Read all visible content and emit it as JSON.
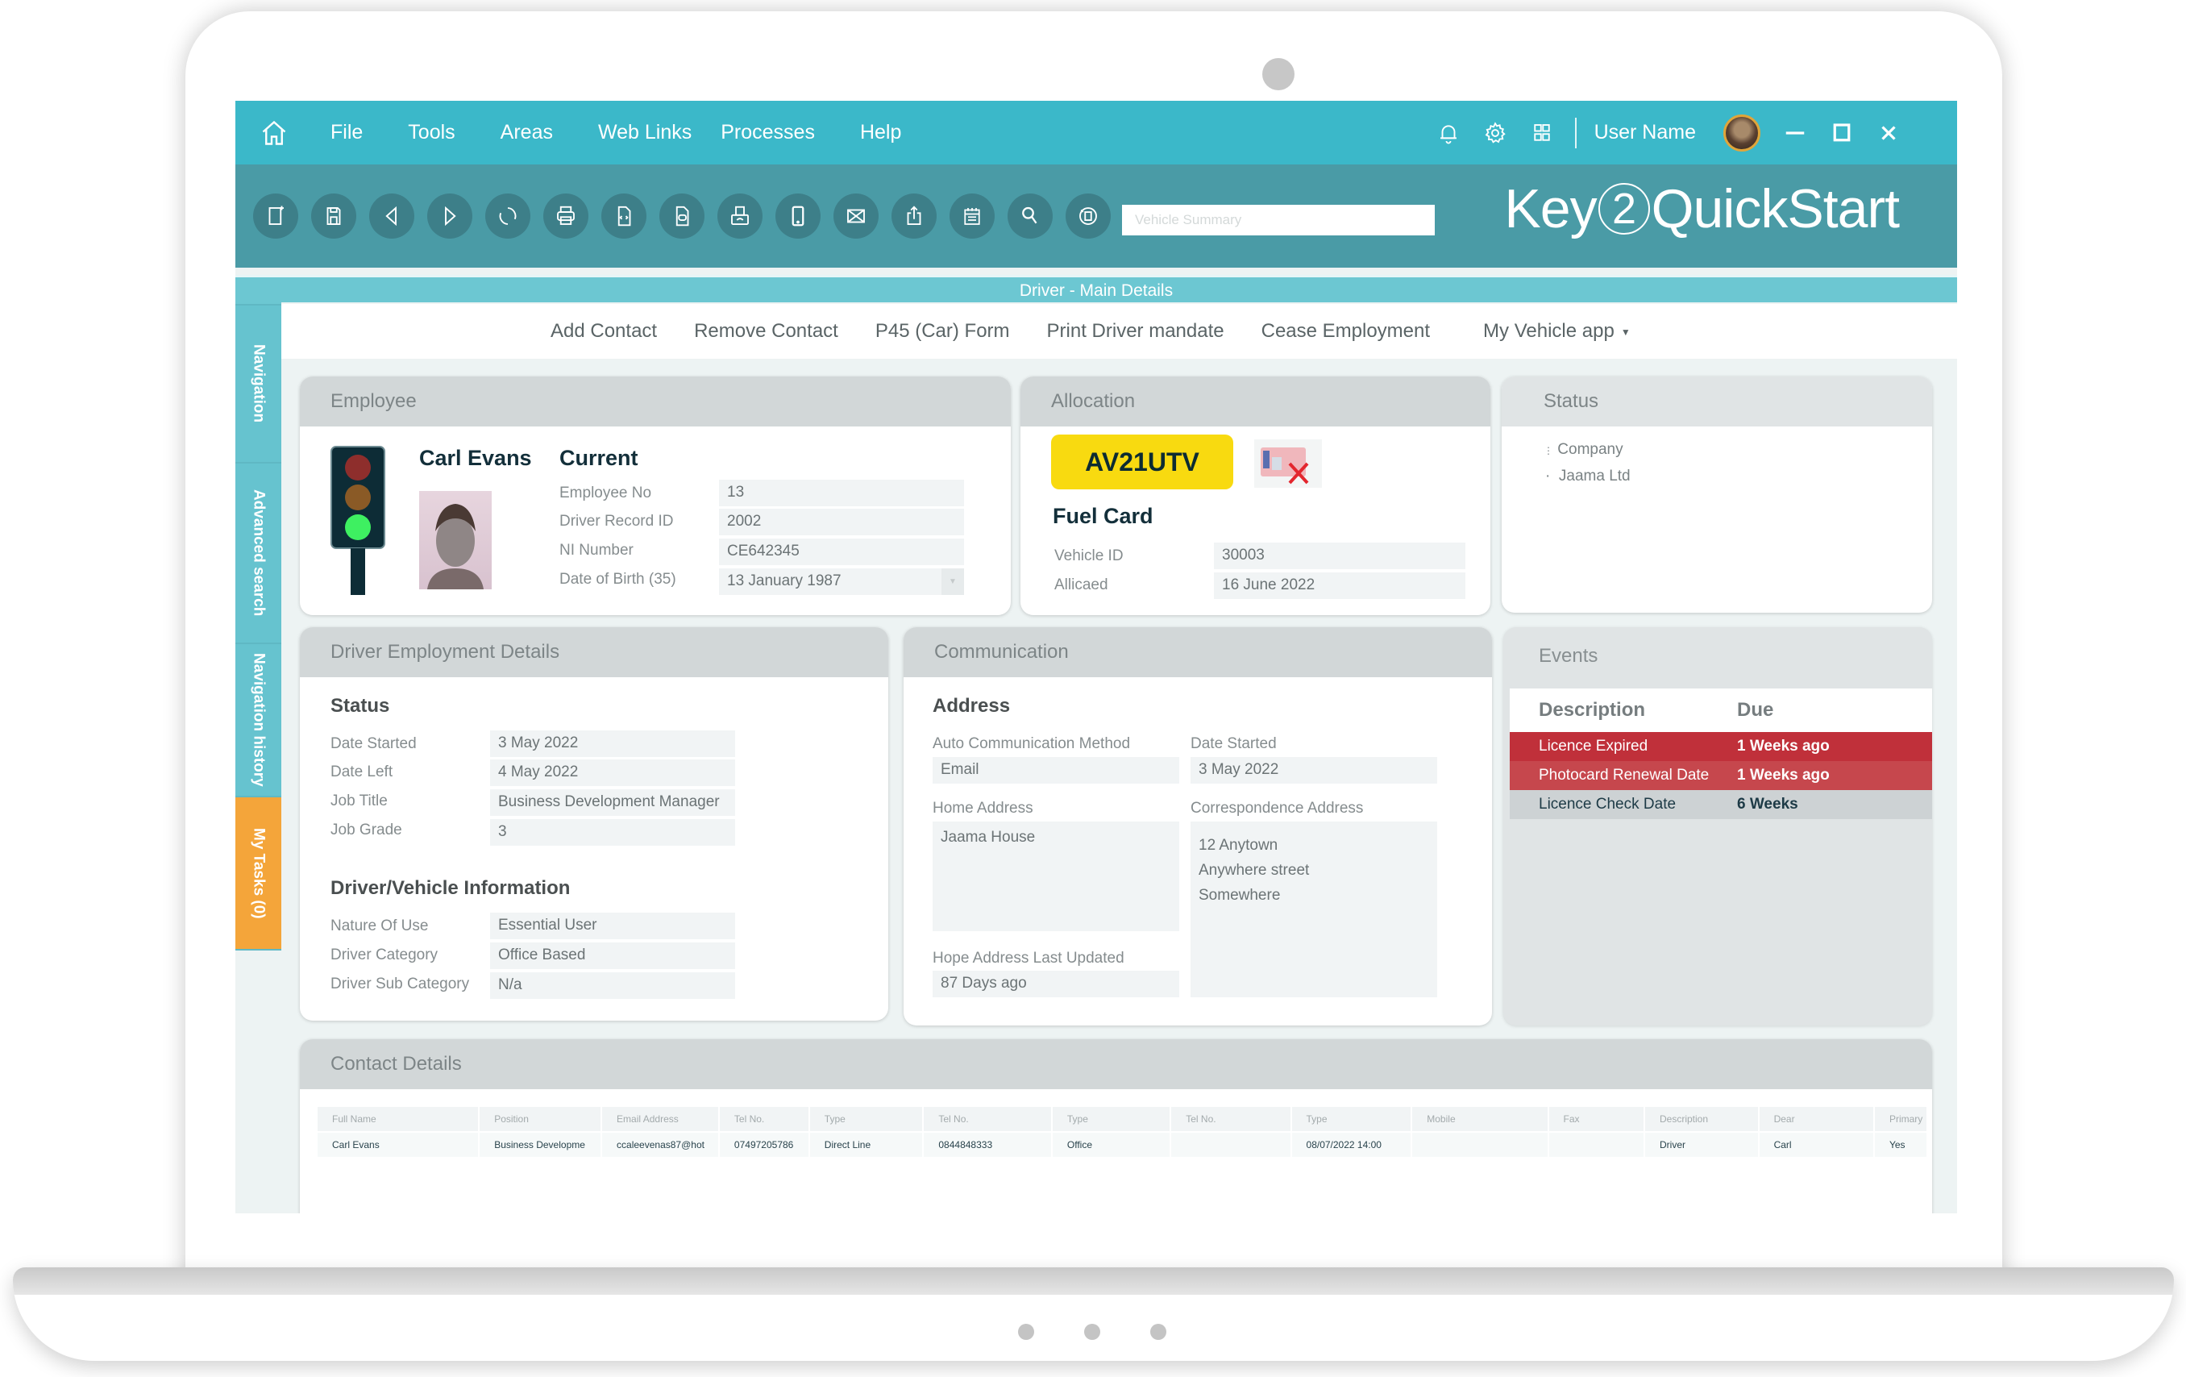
{
  "menu": {
    "items": [
      "File",
      "Tools",
      "Areas",
      "Web Links",
      "Processes",
      "Help"
    ],
    "user_name": "User Name"
  },
  "toolbar": {
    "buttons": [
      "new-document",
      "save",
      "back",
      "forward",
      "refresh",
      "print",
      "document-export",
      "document-import",
      "fax",
      "mobile",
      "email",
      "share",
      "calendar",
      "search",
      "history"
    ],
    "search_placeholder": "Vehicle Summary",
    "brand_prefix": "Key",
    "brand_number": "2",
    "brand_suffix": "QuickStart"
  },
  "page_title": "Driver - Main Details",
  "sidebar": {
    "tabs": [
      "Navigation",
      "Advanced search",
      "Navigation history",
      "My Tasks (0)"
    ]
  },
  "actions": [
    "Add Contact",
    "Remove Contact",
    "P45 (Car) Form",
    "Print Driver mandate",
    "Cease Employment",
    "My Vehicle app"
  ],
  "employee": {
    "title": "Employee",
    "name": "Carl Evans",
    "status": "Current",
    "traffic_light": "green",
    "fields": [
      {
        "label": "Employee No",
        "value": "13"
      },
      {
        "label": "Driver Record ID",
        "value": "2002"
      },
      {
        "label": "NI Number",
        "value": "CE642345"
      },
      {
        "label": "Date of Birth (35)",
        "value": "13 January 1987"
      }
    ]
  },
  "allocation": {
    "title": "Allocation",
    "plate": "AV21UTV",
    "fuel_card_title": "Fuel Card",
    "fields": [
      {
        "label": "Vehicle ID",
        "value": "30003"
      },
      {
        "label": "Allicaed",
        "value": "16 June 2022"
      }
    ]
  },
  "status_panel": {
    "title": "Status",
    "tree": [
      "Company",
      "Jaama Ltd"
    ]
  },
  "employment": {
    "title": "Driver Employment Details",
    "status_heading": "Status",
    "status_fields": [
      {
        "label": "Date Started",
        "value": "3 May 2022"
      },
      {
        "label": "Date Left",
        "value": "4 May 2022"
      },
      {
        "label": "Job Title",
        "value": "Business Development Manager"
      },
      {
        "label": "Job Grade",
        "value": "3"
      }
    ],
    "info_heading": "Driver/Vehicle Information",
    "info_fields": [
      {
        "label": "Nature Of Use",
        "value": "Essential User"
      },
      {
        "label": "Driver Category",
        "value": "Office Based"
      },
      {
        "label": "Driver Sub Category",
        "value": "N/a"
      }
    ]
  },
  "communication": {
    "title": "Communication",
    "heading": "Address",
    "auto_method_label": "Auto Communication Method",
    "auto_method_value": "Email",
    "date_started_label": "Date Started",
    "date_started_value": "3 May 2022",
    "home_address_label": "Home Address",
    "home_address_value": "Jaama House",
    "correspondence_label": "Correspondence Address",
    "correspondence_lines": [
      "12 Anytown",
      "Anywhere street",
      "Somewhere"
    ],
    "last_updated_label": "Hope Address Last Updated",
    "last_updated_value": "87 Days ago"
  },
  "events": {
    "title": "Events",
    "columns": [
      "Description",
      "Due"
    ],
    "rows": [
      {
        "description": "Licence Expired",
        "due": "1 Weeks ago",
        "severity": "overdue"
      },
      {
        "description": "Photocard Renewal Date",
        "due": "1 Weeks ago",
        "severity": "overdue"
      },
      {
        "description": "Licence Check Date",
        "due": "6 Weeks",
        "severity": "upcoming"
      }
    ]
  },
  "contacts": {
    "title": "Contact Details",
    "columns": [
      "Full Name",
      "Position",
      "Email Address",
      "Tel No.",
      "Type",
      "Tel No.",
      "Type",
      "Tel No.",
      "Type",
      "Mobile",
      "Fax",
      "Description",
      "Dear",
      "Primary"
    ],
    "rows": [
      [
        "Carl Evans",
        "Business Developme",
        "ccaleevenas87@hot",
        "07497205786",
        "Direct Line",
        "0844848333",
        "Office",
        "",
        "08/07/2022 14:00",
        "",
        "",
        "Driver",
        "Carl",
        "Yes"
      ]
    ]
  },
  "colors": {
    "menu_bar": "#3bb8c9",
    "toolbar": "#4a9ba6",
    "sidebar_tab": "#66c3cf",
    "tasks_tab": "#f4a53a",
    "plate": "#f8da10",
    "event_overdue": "#c0303a",
    "event_upcoming": "#cdd2d4"
  }
}
